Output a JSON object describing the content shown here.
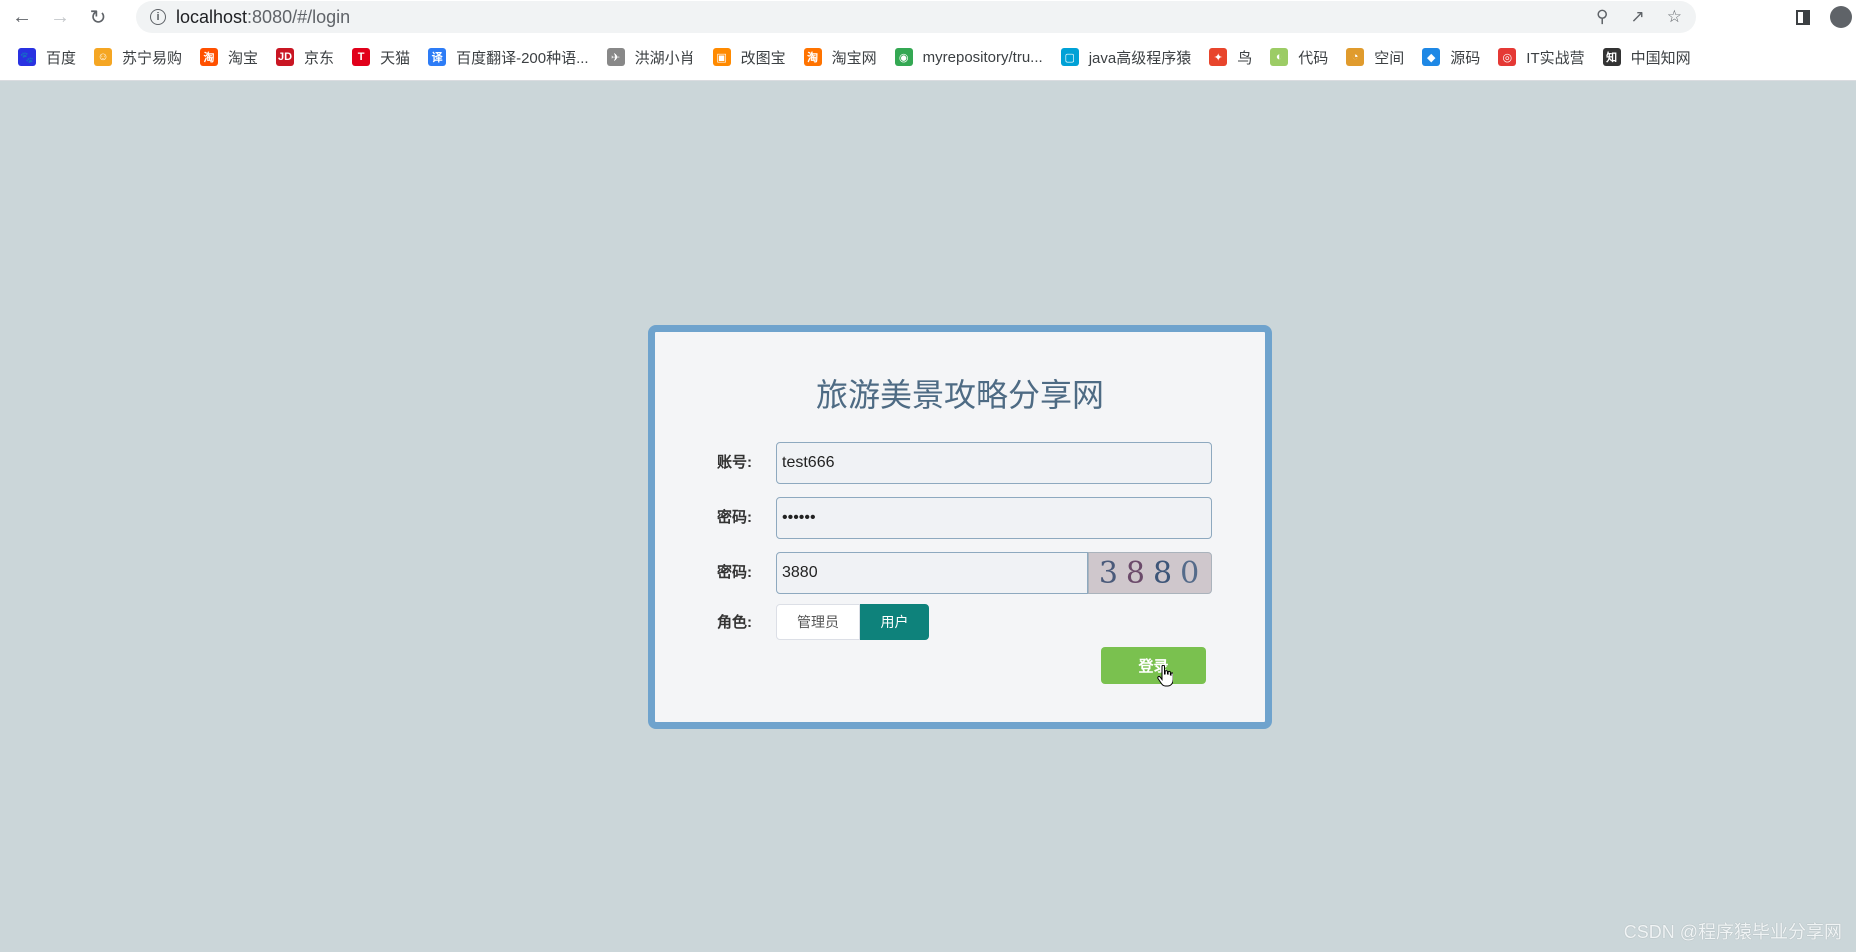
{
  "browser": {
    "url_host": "localhost",
    "url_path": ":8080/#/login",
    "bookmarks": [
      {
        "label": "百度",
        "icon": "baidu-icon",
        "color": "#2932e1",
        "glyph": "🐾"
      },
      {
        "label": "苏宁易购",
        "icon": "suning-icon",
        "color": "#f5a623",
        "glyph": "☺"
      },
      {
        "label": "淘宝",
        "icon": "taobao-icon",
        "color": "#ff5000",
        "glyph": "淘"
      },
      {
        "label": "京东",
        "icon": "jd-icon",
        "color": "#c91623",
        "glyph": "JD"
      },
      {
        "label": "天猫",
        "icon": "tmall-icon",
        "color": "#e1001a",
        "glyph": "T"
      },
      {
        "label": "百度翻译-200种语...",
        "icon": "baidu-translate-icon",
        "color": "#2d7cf6",
        "glyph": "译"
      },
      {
        "label": "洪湖小肖",
        "icon": "bird-icon",
        "color": "#888888",
        "glyph": "✈"
      },
      {
        "label": "改图宝",
        "icon": "gaitubao-icon",
        "color": "#ff8a00",
        "glyph": "▣"
      },
      {
        "label": "淘宝网",
        "icon": "taobao-net-icon",
        "color": "#ff7300",
        "glyph": "淘"
      },
      {
        "label": "myrepository/tru...",
        "icon": "chrome-icon",
        "color": "#34a853",
        "glyph": "◉"
      },
      {
        "label": "java高级程序猿",
        "icon": "bilibili-icon",
        "color": "#00a1d6",
        "glyph": "▢"
      },
      {
        "label": "鸟",
        "icon": "bird-red-icon",
        "color": "#e8452c",
        "glyph": "✦"
      },
      {
        "label": "代码",
        "icon": "code-icon",
        "color": "#9ccc65",
        "glyph": "◐"
      },
      {
        "label": "空间",
        "icon": "space-icon",
        "color": "#e09b2d",
        "glyph": "◔"
      },
      {
        "label": "源码",
        "icon": "source-icon",
        "color": "#1e88e5",
        "glyph": "◆"
      },
      {
        "label": "IT实战营",
        "icon": "it-camp-icon",
        "color": "#e53935",
        "glyph": "◎"
      },
      {
        "label": "中国知网",
        "icon": "cnki-icon",
        "color": "#333333",
        "glyph": "知"
      }
    ]
  },
  "login": {
    "title": "旅游美景攻略分享网",
    "account_label": "账号:",
    "account_value": "test666",
    "password_label": "密码:",
    "password_value": "••••••",
    "captcha_label": "密码:",
    "captcha_value": "3880",
    "captcha_digits": [
      "3",
      "8",
      "8",
      "0"
    ],
    "role_label": "角色:",
    "role_admin": "管理员",
    "role_user": "用户",
    "selected_role": "用户",
    "login_button": "登录"
  },
  "watermark": "CSDN @程序猿毕业分享网",
  "colors": {
    "page_bg": "#cbd6d9",
    "card_border": "#6fa3cd",
    "selected_role_bg": "#0e827b",
    "login_button_bg": "#7ac14f"
  }
}
